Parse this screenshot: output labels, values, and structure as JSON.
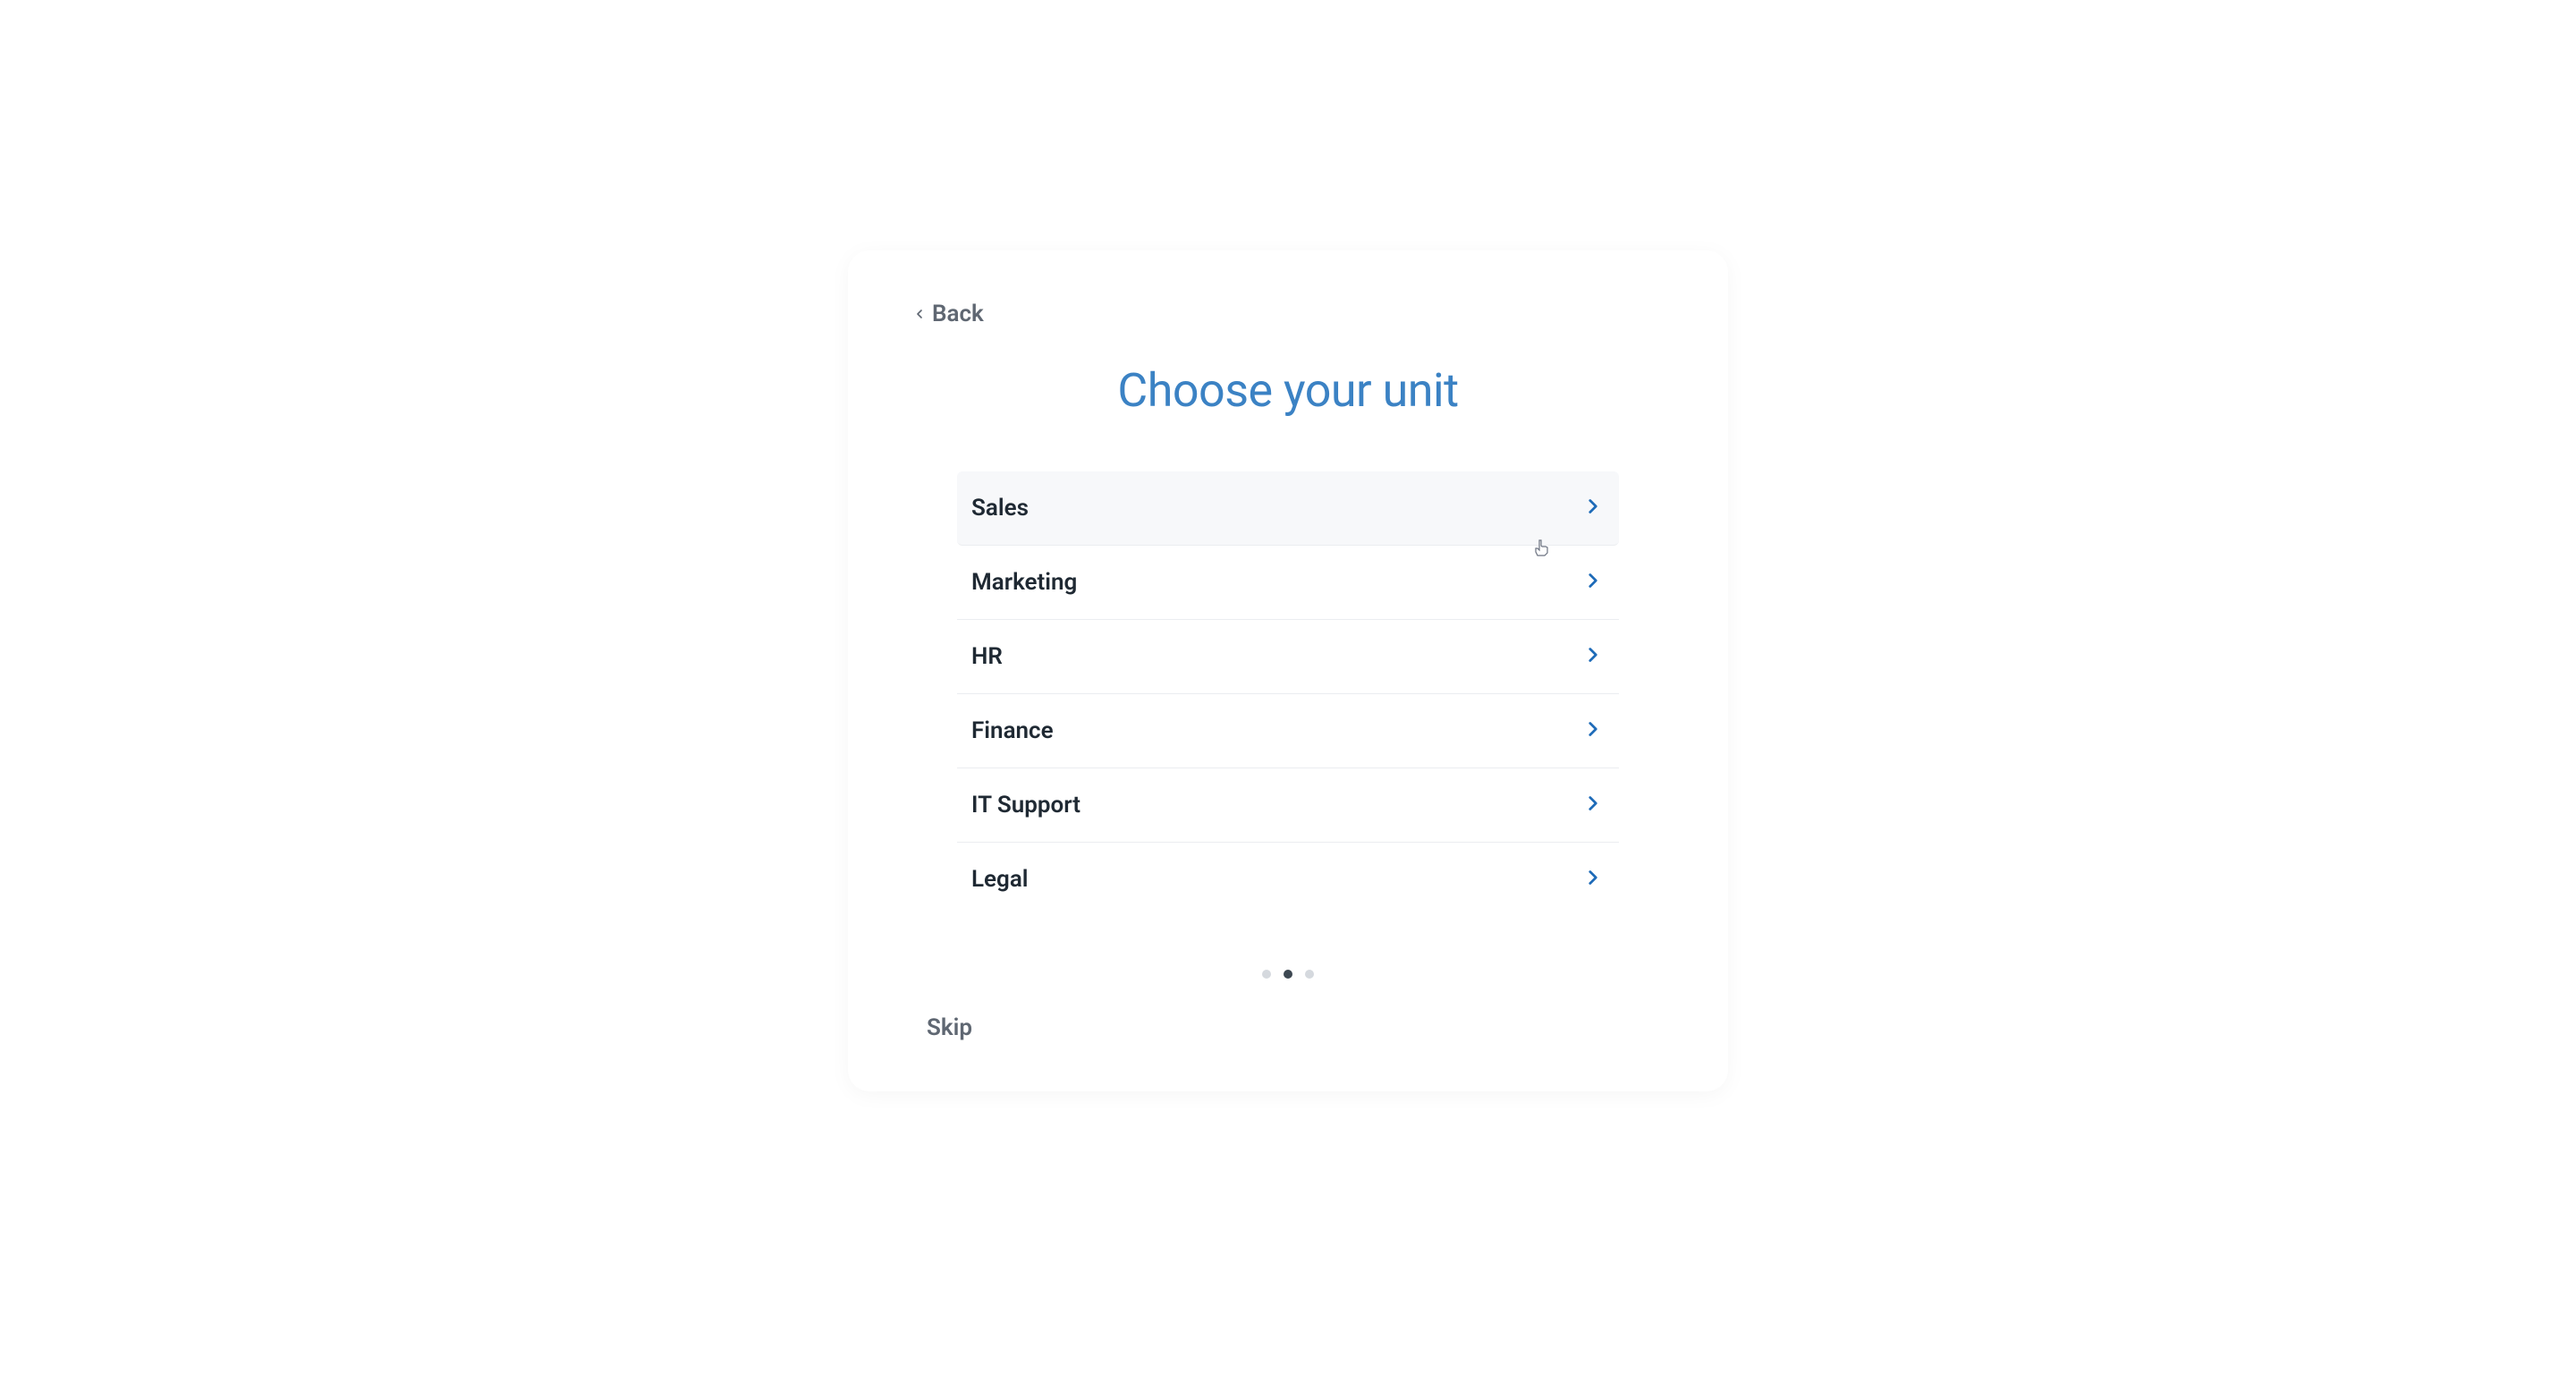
{
  "back_label": "Back",
  "title": "Choose your unit",
  "units": [
    {
      "label": "Sales",
      "hovered": true
    },
    {
      "label": "Marketing",
      "hovered": false
    },
    {
      "label": "HR",
      "hovered": false
    },
    {
      "label": "Finance",
      "hovered": false
    },
    {
      "label": "IT Support",
      "hovered": false
    },
    {
      "label": "Legal",
      "hovered": false
    }
  ],
  "pagination": {
    "total": 3,
    "active_index": 1
  },
  "skip_label": "Skip",
  "colors": {
    "accent": "#3b82c4",
    "chevron": "#1e6bb8",
    "text_primary": "#1f2933",
    "text_secondary": "#5f6772"
  }
}
